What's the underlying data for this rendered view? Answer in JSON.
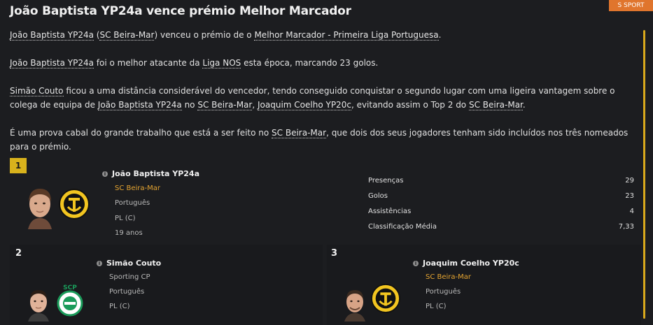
{
  "source_tag": "S SPORT",
  "headline": "João Baptista YP24a vence prémio Melhor Marcador",
  "article": {
    "p1": {
      "player": "João Baptista YP24a",
      "open": " (",
      "club": "SC Beira-Mar",
      "mid": ") venceu o prémio de o ",
      "award": "Melhor Marcador - Primeira Liga Portuguesa",
      "end": "."
    },
    "p2": {
      "player": "João Baptista YP24a",
      "mid": " foi o melhor atacante da ",
      "league": "Liga NOS",
      "end": " esta época, marcando 23 golos."
    },
    "p3": {
      "player": "Simão Couto",
      "t1": " ficou a uma distância considerável do vencedor, tendo conseguido conquistar o segundo lugar com uma ligeira vantagem sobre o colega de equipa de ",
      "player2": "João Baptista YP24a",
      "t2": " no ",
      "club": "SC Beira-Mar",
      "t3": ", ",
      "player3": "Joaquim Coelho YP20c",
      "t4": ", evitando assim o Top 2 do ",
      "club2": "SC Beira-Mar",
      "end": "."
    },
    "p4": {
      "t1": "É uma prova cabal do grande trabalho que está a ser feito no ",
      "club": "SC Beira-Mar",
      "t2": ", que dois dos seus jogadores tenham sido incluídos nos três nomeados para o prémio."
    }
  },
  "nominees": [
    {
      "rank": "1",
      "name": "João Baptista YP24a",
      "club": "SC Beira-Mar",
      "nationality": "Português",
      "position": "PL (C)",
      "age": "19 anos",
      "stats": [
        {
          "label": "Presenças",
          "value": "29"
        },
        {
          "label": "Golos",
          "value": "23"
        },
        {
          "label": "Assistências",
          "value": "4"
        },
        {
          "label": "Classificação Média",
          "value": "7,33"
        }
      ]
    },
    {
      "rank": "2",
      "name": "Simão Couto",
      "club": "Sporting CP",
      "nationality": "Português",
      "position": "PL (C)"
    },
    {
      "rank": "3",
      "name": "Joaquim Coelho YP20c",
      "club": "SC Beira-Mar",
      "nationality": "Português",
      "position": "PL (C)"
    }
  ],
  "colors": {
    "background": "#1c1d20",
    "accent_gold": "#d8b21c",
    "club_link": "#e6a531",
    "source_tag": "#e0752d"
  }
}
